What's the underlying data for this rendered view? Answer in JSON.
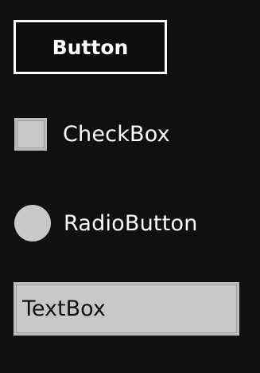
{
  "button": {
    "label": "Button"
  },
  "checkbox": {
    "label": "CheckBox",
    "checked": false
  },
  "radio": {
    "label": "RadioButton",
    "selected": false
  },
  "textbox": {
    "value": "TextBox"
  },
  "colors": {
    "background": "#101010",
    "control_fill": "#c8c8c8",
    "border": "#ffffff",
    "text": "#ffffff"
  }
}
